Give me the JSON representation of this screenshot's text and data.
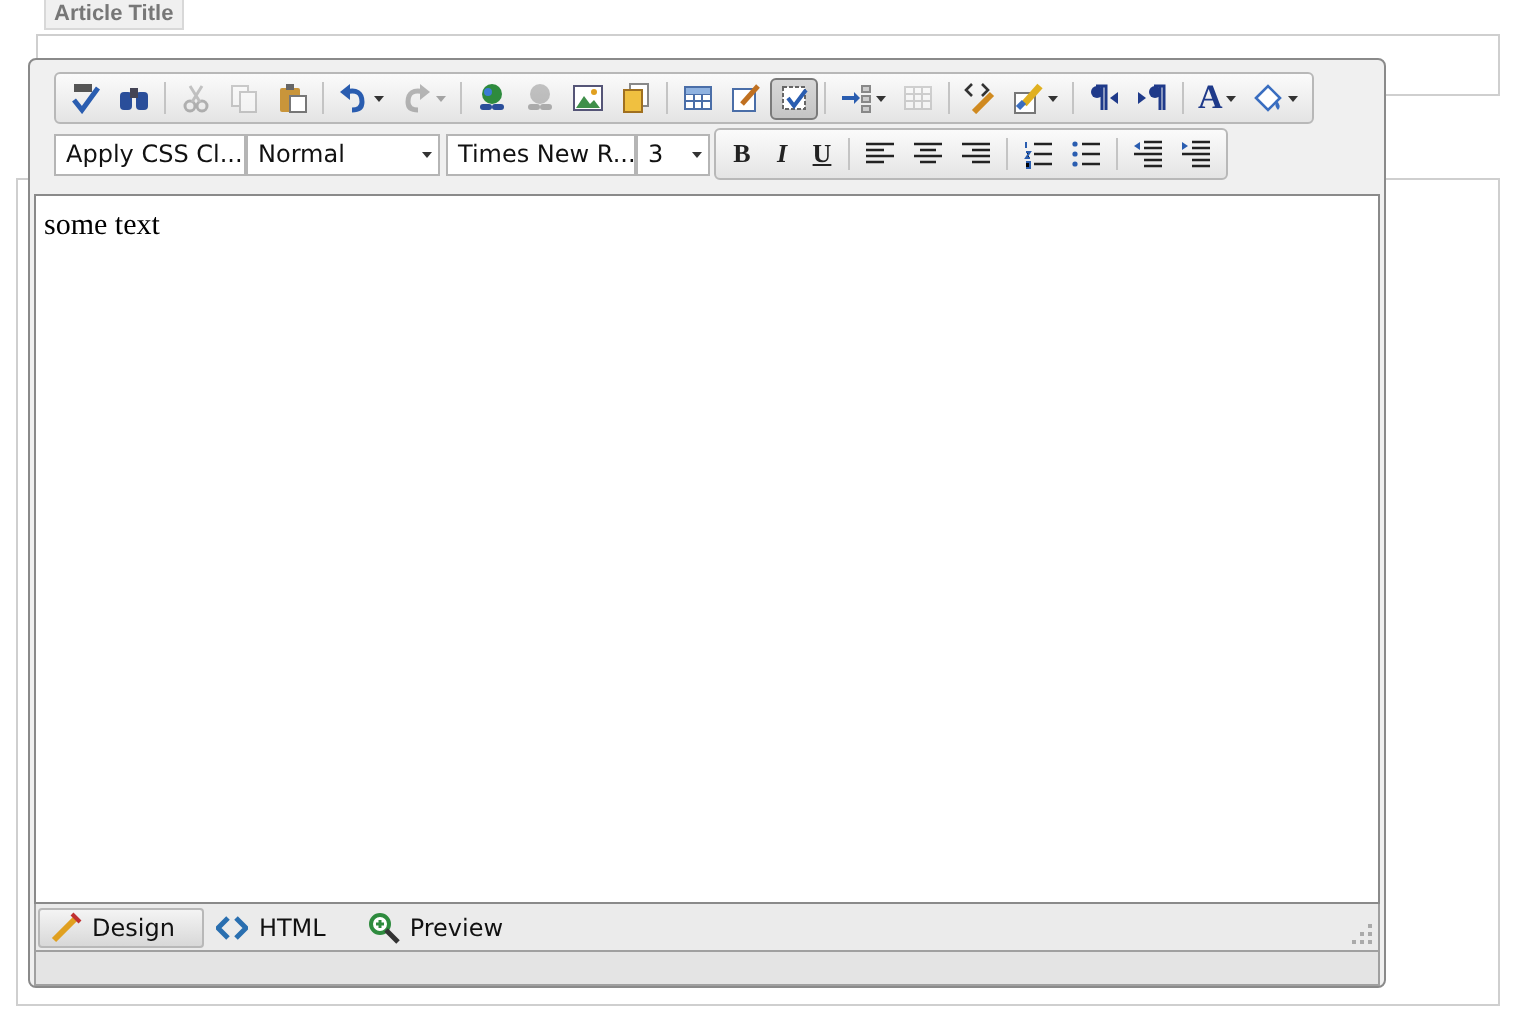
{
  "form": {
    "title_label": "Article Title"
  },
  "editor": {
    "toolbar_row1": [
      [
        {
          "kind": "icon",
          "disabled": false,
          "selected": false,
          "dropdown": false
        },
        {
          "kind": "icon",
          "disabled": false,
          "selected": false,
          "dropdown": false
        }
      ],
      [
        {
          "kind": "icon",
          "disabled": true,
          "selected": false,
          "dropdown": false
        },
        {
          "kind": "icon",
          "disabled": true,
          "selected": false,
          "dropdown": false
        },
        {
          "kind": "icon",
          "disabled": false,
          "selected": false,
          "dropdown": false
        }
      ],
      [
        {
          "kind": "icon",
          "disabled": false,
          "selected": false,
          "dropdown": true
        },
        {
          "kind": "icon",
          "disabled": true,
          "selected": false,
          "dropdown": true
        }
      ],
      [
        {
          "kind": "icon",
          "disabled": false,
          "selected": false,
          "dropdown": false
        },
        {
          "kind": "icon",
          "disabled": true,
          "selected": false,
          "dropdown": false
        },
        {
          "kind": "icon",
          "disabled": false,
          "selected": false,
          "dropdown": false
        },
        {
          "kind": "icon",
          "disabled": false,
          "selected": false,
          "dropdown": false
        }
      ],
      [
        {
          "kind": "icon",
          "disabled": false,
          "selected": false,
          "dropdown": false
        },
        {
          "kind": "icon",
          "disabled": false,
          "selected": false,
          "dropdown": false
        },
        {
          "kind": "icon",
          "disabled": false,
          "selected": true,
          "dropdown": false
        }
      ],
      [
        {
          "kind": "icon",
          "disabled": false,
          "selected": false,
          "dropdown": true
        },
        {
          "kind": "icon",
          "disabled": true,
          "selected": false,
          "dropdown": false
        }
      ],
      [
        {
          "kind": "icon",
          "disabled": false,
          "selected": false,
          "dropdown": false
        },
        {
          "kind": "icon",
          "disabled": false,
          "selected": false,
          "dropdown": true
        }
      ],
      [
        {
          "kind": "icon",
          "disabled": false,
          "selected": false,
          "dropdown": false
        },
        {
          "kind": "icon",
          "disabled": false,
          "selected": false,
          "dropdown": false
        }
      ],
      [
        {
          "kind": "glyph",
          "text": "A",
          "disabled": false,
          "selected": false,
          "dropdown": true
        },
        {
          "kind": "icon",
          "disabled": false,
          "selected": false,
          "dropdown": true
        }
      ]
    ],
    "dropdowns": [
      {
        "value": "Apply CSS Cl..."
      },
      {
        "value": "Normal"
      },
      {
        "value": "Times New R..."
      },
      {
        "value": "3"
      }
    ],
    "toolbar_row2": [
      [
        {
          "kind": "glyph",
          "text": "B",
          "disabled": false,
          "selected": false,
          "dropdown": false
        },
        {
          "kind": "glyph",
          "text": "I",
          "disabled": false,
          "selected": false,
          "dropdown": false
        },
        {
          "kind": "glyph",
          "text": "U",
          "disabled": false,
          "selected": false,
          "dropdown": false
        }
      ],
      [
        {
          "kind": "icon",
          "disabled": false,
          "selected": false,
          "dropdown": false
        },
        {
          "kind": "icon",
          "disabled": false,
          "selected": false,
          "dropdown": false
        },
        {
          "kind": "icon",
          "disabled": false,
          "selected": false,
          "dropdown": false
        }
      ],
      [
        {
          "kind": "icon",
          "disabled": false,
          "selected": false,
          "dropdown": false
        },
        {
          "kind": "icon",
          "disabled": false,
          "selected": false,
          "dropdown": false
        }
      ],
      [
        {
          "kind": "icon",
          "disabled": false,
          "selected": false,
          "dropdown": false
        },
        {
          "kind": "icon",
          "disabled": false,
          "selected": false,
          "dropdown": false
        }
      ]
    ],
    "content": "some text",
    "modes": [
      {
        "label": "Design",
        "selected": true
      },
      {
        "label": "HTML",
        "selected": false
      },
      {
        "label": "Preview",
        "selected": false
      }
    ]
  }
}
